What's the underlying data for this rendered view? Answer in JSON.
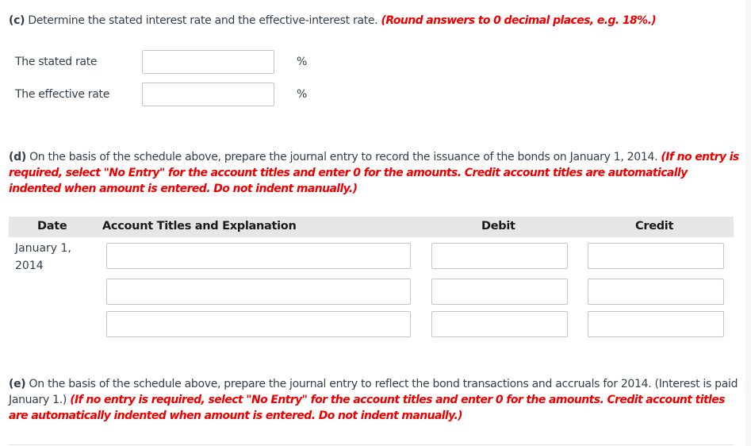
{
  "part_c": {
    "label": "(c)",
    "text": " Determine the stated interest rate and the effective-interest rate. ",
    "instruction": "(Round answers to 0 decimal places, e.g. 18%.)",
    "fields": [
      {
        "label": "The stated rate",
        "value": "",
        "unit": "%"
      },
      {
        "label": "The effective rate",
        "value": "",
        "unit": "%"
      }
    ]
  },
  "part_d": {
    "label": "(d)",
    "text": " On the basis of the schedule above, prepare the journal entry to record the issuance of the bonds on January 1, 2014. ",
    "instruction": "(If no entry is required, select \"No Entry\" for the account titles and enter 0 for the amounts. Credit account titles are automatically indented when amount is entered. Do not indent manually.)",
    "table": {
      "headers": {
        "date": "Date",
        "account": "Account Titles and Explanation",
        "debit": "Debit",
        "credit": "Credit"
      },
      "date_line1": "January 1,",
      "date_line2": "2014",
      "rows": [
        {
          "account": "",
          "debit": "",
          "credit": ""
        },
        {
          "account": "",
          "debit": "",
          "credit": ""
        },
        {
          "account": "",
          "debit": "",
          "credit": ""
        }
      ]
    }
  },
  "part_e": {
    "label": "(e)",
    "text": " On the basis of the schedule above, prepare the journal entry to reflect the bond transactions and accruals for 2014. (Interest is paid January 1.) ",
    "instruction": "(If no entry is required, select \"No Entry\" for the account titles and enter 0 for the amounts. Credit account titles are automatically indented when amount is entered. Do not indent manually.)"
  },
  "colors": {
    "instruction_red": "#ee0000",
    "header_bg": "#e6e6e6",
    "text": "#333f48"
  }
}
